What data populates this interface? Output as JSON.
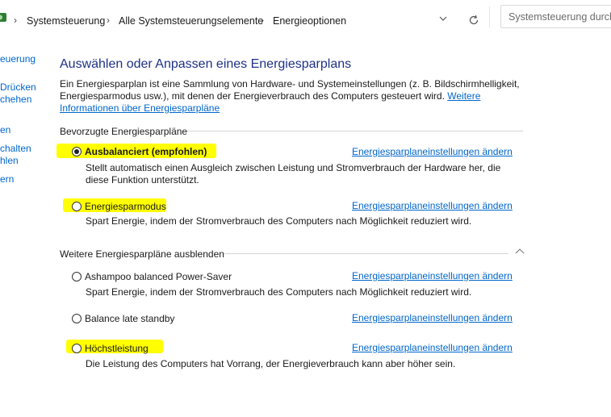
{
  "address_bar": {
    "breadcrumbs": [
      "Systemsteuerung",
      "Alle Systemsteuerungselemente",
      "Energieoptionen"
    ],
    "separator": "›",
    "search_placeholder": "Systemsteuerung durchsuchen"
  },
  "left_pane": {
    "items": [
      "euerung",
      "Drücken",
      "chehen",
      "en",
      "chalten",
      "hlen",
      "ern"
    ]
  },
  "main": {
    "title": "Auswählen oder Anpassen eines Energiesparplans",
    "description": "Ein Energiesparplan ist eine Sammlung von Hardware- und Systemeinstellungen (z. B. Bildschirmhelligkeit, Energiesparmodus usw.), mit denen der Energieverbrauch des Computers gesteuert wird.",
    "more_info_link": "Weitere Informationen über Energiesparpläne",
    "preferred_section": "Bevorzugte Energiesparpläne",
    "hidden_section": "Weitere Energiesparpläne ausblenden",
    "change_link": "Energiesparplaneinstellungen ändern",
    "preferred_plans": [
      {
        "name": "Ausbalanciert (empfohlen)",
        "selected": true,
        "description_line1": "Stellt automatisch einen Ausgleich zwischen Leistung und Stromverbrauch der Hardware her, die",
        "description_line2": "diese Funktion unterstützt."
      },
      {
        "name": "Energiesparmodus",
        "selected": false,
        "description_line1": "Spart Energie, indem der Stromverbrauch des Computers nach Möglichkeit reduziert wird.",
        "description_line2": ""
      }
    ],
    "hidden_plans": [
      {
        "name": "Ashampoo balanced Power-Saver",
        "selected": false,
        "description_line1": "Spart Energie, indem der Stromverbrauch des Computers nach Möglichkeit reduziert wird."
      },
      {
        "name": "Balance late standby",
        "selected": false,
        "description_line1": ""
      },
      {
        "name": "Höchstleistung",
        "selected": false,
        "description_line1": "Die Leistung des Computers hat Vorrang, der Energieverbrauch kann aber höher sein."
      }
    ]
  },
  "colors": {
    "highlight": "#ffff00",
    "link": "#0066cc",
    "title": "#1e3287"
  }
}
